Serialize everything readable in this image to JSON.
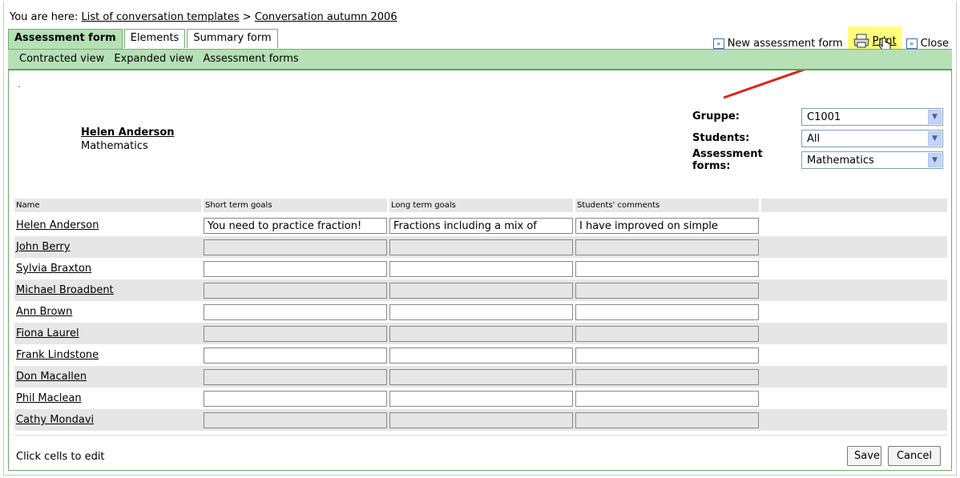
{
  "breadcrumb": {
    "prefix": "You are here:",
    "link1": "List of conversation templates",
    "separator": ">",
    "link2": "Conversation autumn 2006"
  },
  "tabs": [
    {
      "label": "Assessment form",
      "active": true
    },
    {
      "label": "Elements",
      "active": false
    },
    {
      "label": "Summary form",
      "active": false
    }
  ],
  "actions": {
    "new_form": "New assessment form",
    "print": "Print",
    "close": "Close"
  },
  "subnav": [
    "Contracted view",
    "Expanded view",
    "Assessment forms"
  ],
  "marker": ".",
  "person": {
    "name": "Helen Anderson",
    "subject": "Mathematics"
  },
  "filters": {
    "group_label": "Gruppe:",
    "group_value": "C1001",
    "students_label": "Students:",
    "students_value": "All",
    "forms_label": "Assessment forms:",
    "forms_value": "Mathematics"
  },
  "table": {
    "headers": [
      "Name",
      "Short term goals",
      "Long term goals",
      "Students' comments",
      ""
    ],
    "rows": [
      {
        "name": "Helen Anderson",
        "short": "You need to practice fraction!",
        "long": "Fractions including a mix of",
        "comments": "I have improved on simple"
      },
      {
        "name": "John Berry",
        "short": "",
        "long": "",
        "comments": ""
      },
      {
        "name": "Sylvia Braxton",
        "short": "",
        "long": "",
        "comments": ""
      },
      {
        "name": "Michael Broadbent",
        "short": "",
        "long": "",
        "comments": ""
      },
      {
        "name": "Ann Brown",
        "short": "",
        "long": "",
        "comments": ""
      },
      {
        "name": "Fiona Laurel",
        "short": "",
        "long": "",
        "comments": ""
      },
      {
        "name": "Frank Lindstone",
        "short": "",
        "long": "",
        "comments": ""
      },
      {
        "name": "Don Macallen",
        "short": "",
        "long": "",
        "comments": ""
      },
      {
        "name": "Phil Maclean",
        "short": "",
        "long": "",
        "comments": ""
      },
      {
        "name": "Cathy Mondavi",
        "short": "",
        "long": "",
        "comments": ""
      }
    ]
  },
  "footer": {
    "hint": "Click cells to edit",
    "save": "Save",
    "cancel": "Cancel"
  },
  "colors": {
    "tab_green": "#b6e0b6",
    "border_green": "#6fae6f",
    "highlight": "#ffff7a",
    "arrow_red": "#e0201b"
  }
}
